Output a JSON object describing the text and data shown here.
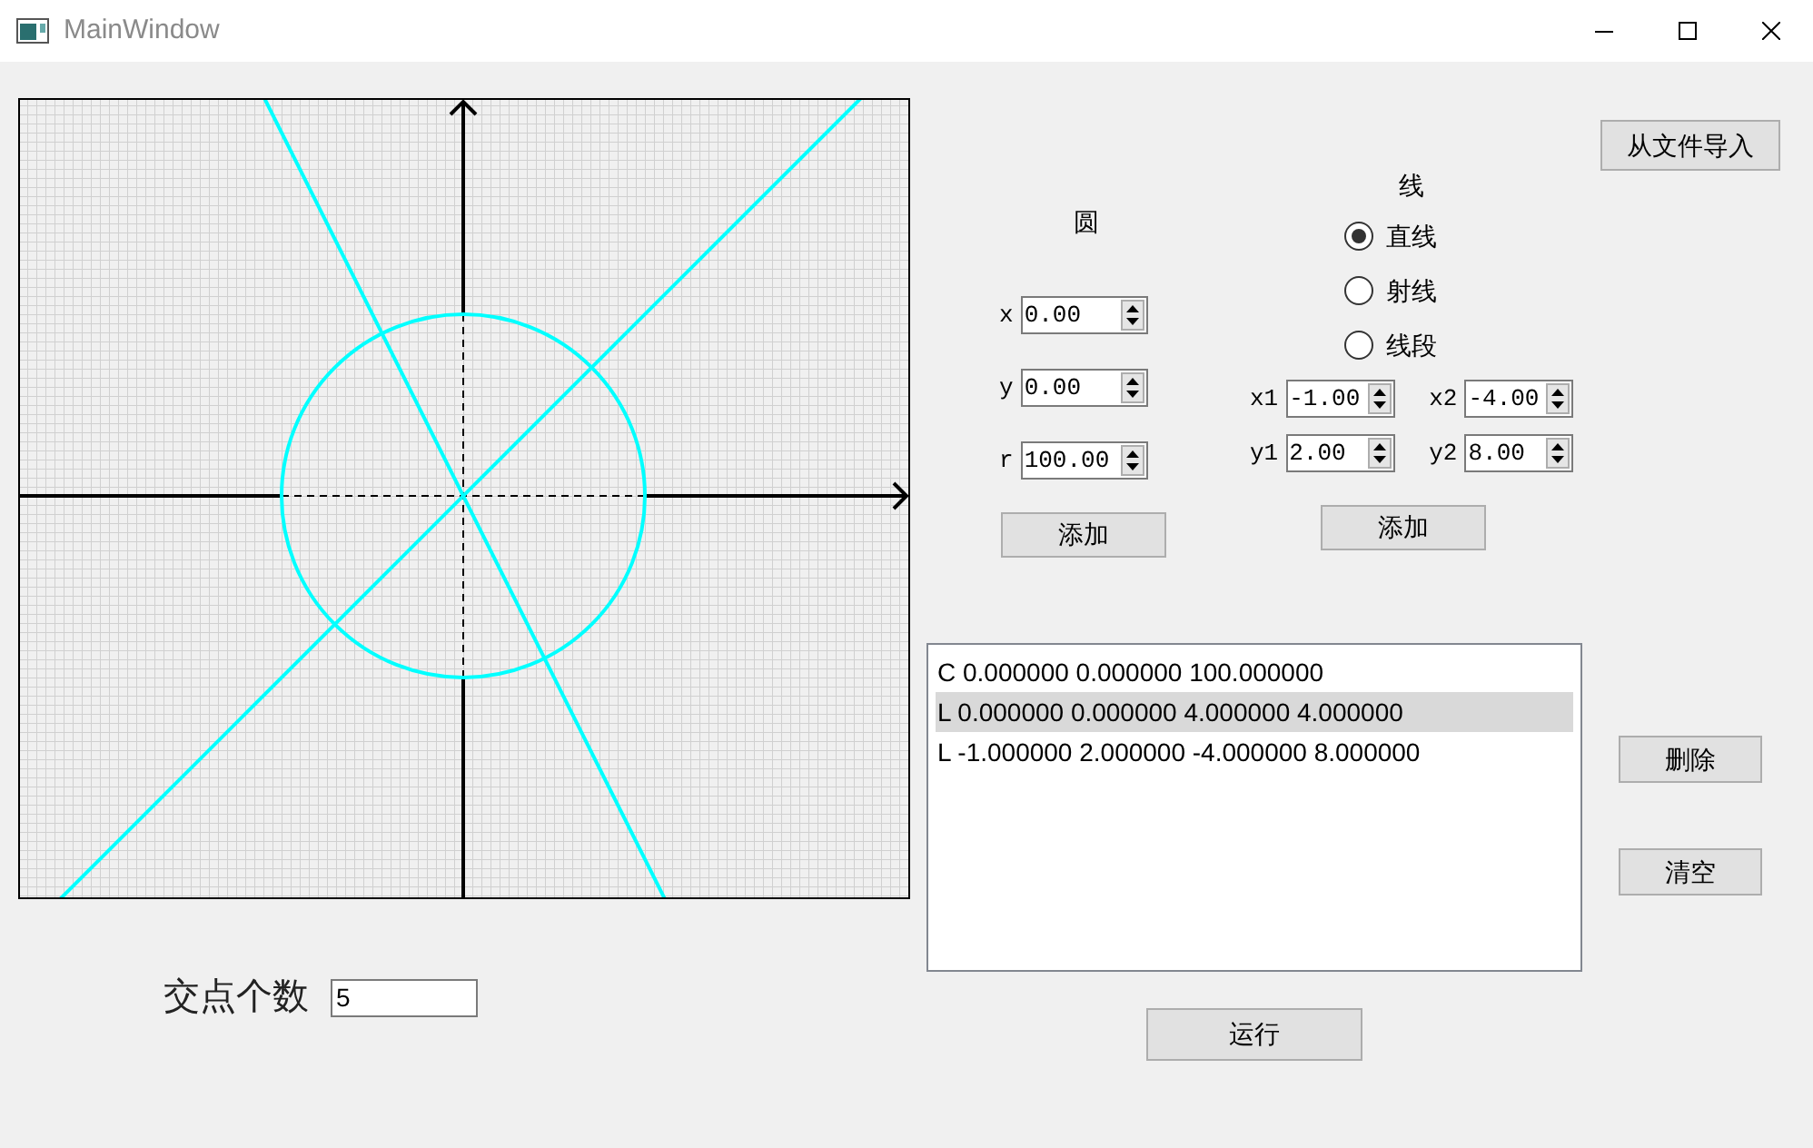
{
  "window": {
    "title": "MainWindow"
  },
  "circle": {
    "title": "圆",
    "fields": [
      {
        "label": "x",
        "value": "0.00"
      },
      {
        "label": "y",
        "value": "0.00"
      },
      {
        "label": "r",
        "value": "100.00"
      }
    ],
    "add_button": "添加"
  },
  "line": {
    "title": "线",
    "radios": [
      {
        "label": "直线",
        "selected": true
      },
      {
        "label": "射线",
        "selected": false
      },
      {
        "label": "线段",
        "selected": false
      }
    ],
    "fields": [
      {
        "label": "x1",
        "value": "-1.00"
      },
      {
        "label": "x2",
        "value": "-4.00"
      },
      {
        "label": "y1",
        "value": "2.00"
      },
      {
        "label": "y2",
        "value": "8.00"
      }
    ],
    "add_button": "添加"
  },
  "import_button": "从文件导入",
  "list": [
    {
      "text": "C 0.000000 0.000000 100.000000",
      "selected": false
    },
    {
      "text": "L 0.000000 0.000000 4.000000 4.000000",
      "selected": true
    },
    {
      "text": "L -1.000000 2.000000 -4.000000 8.000000",
      "selected": false
    }
  ],
  "delete_button": "删除",
  "clear_button": "清空",
  "run_button": "运行",
  "count": {
    "label": "交点个数",
    "value": "5"
  }
}
